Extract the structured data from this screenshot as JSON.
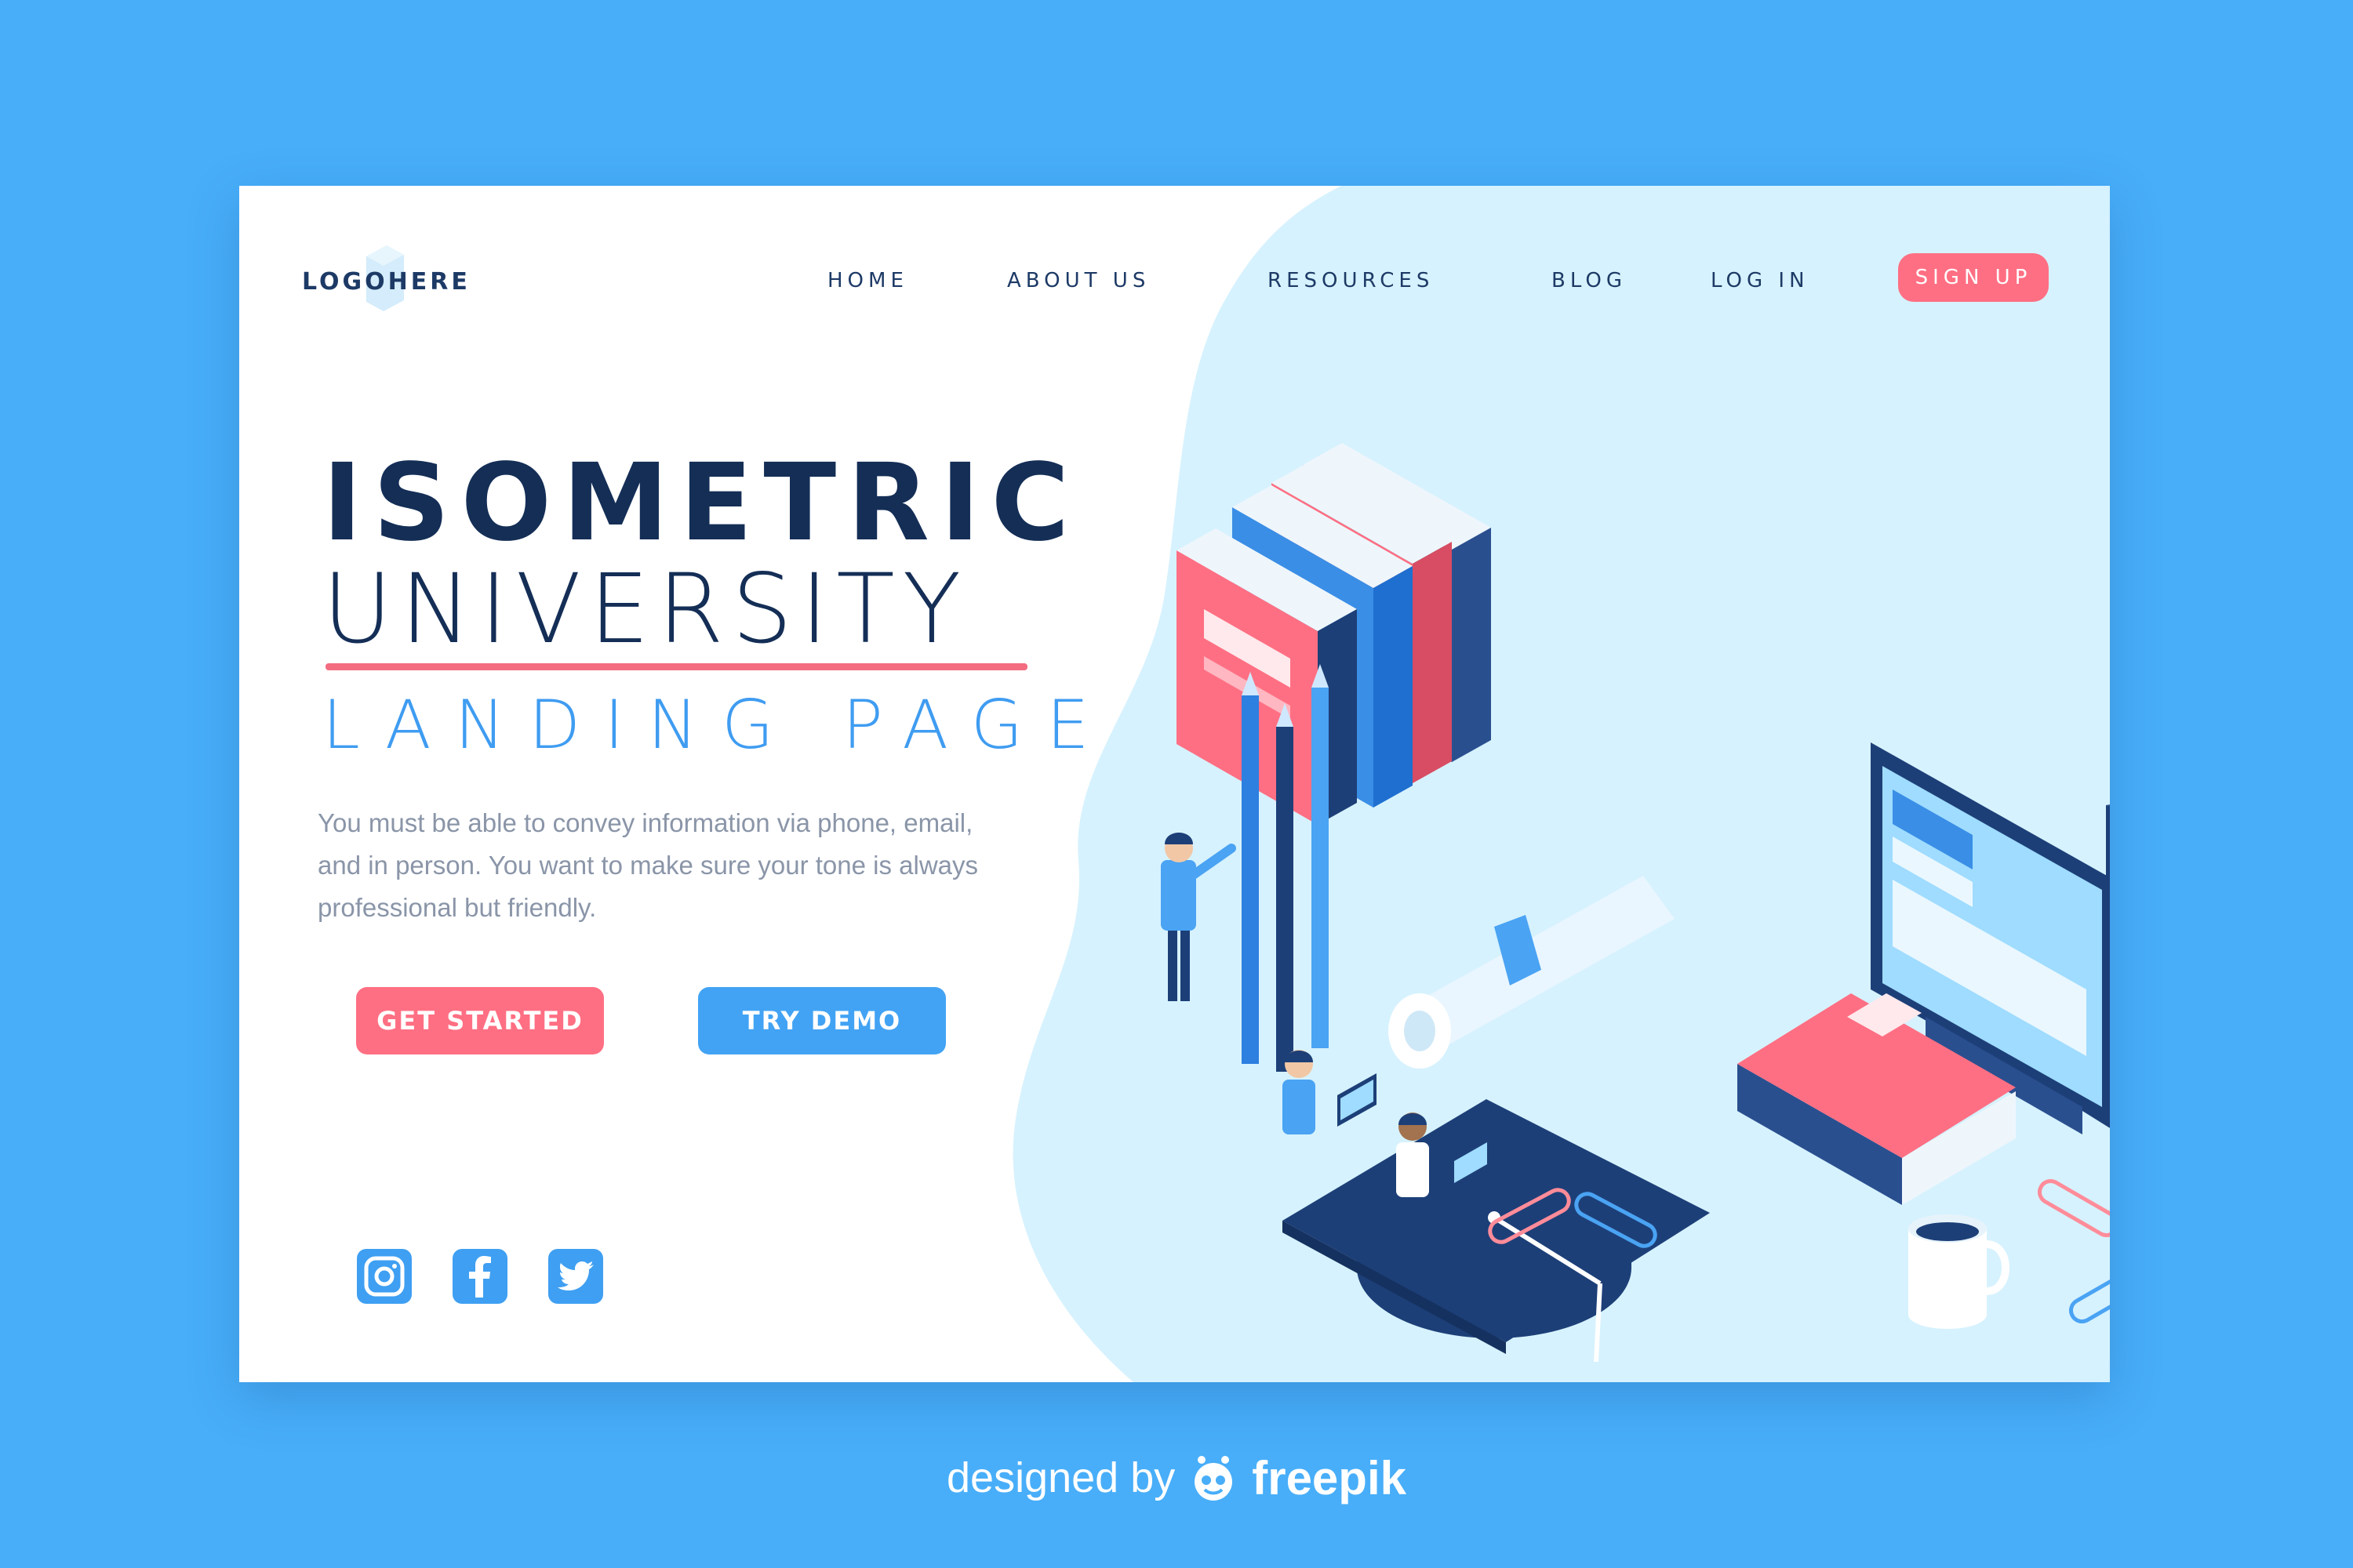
{
  "colors": {
    "page_background": "#48aef9",
    "card_background": "#ffffff",
    "blob": "#d6f2fe",
    "navy": "#142e56",
    "accent_pink": "#ff6f83",
    "accent_blue": "#42a3f4"
  },
  "header": {
    "logo": "LOGOHERE",
    "nav": [
      {
        "label": "HOME"
      },
      {
        "label": "ABOUT US"
      },
      {
        "label": "RESOURCES"
      },
      {
        "label": "BLOG"
      },
      {
        "label": "LOG IN"
      }
    ],
    "signup_label": "SIGN UP"
  },
  "hero": {
    "title_line1": "ISOMETRIC",
    "title_line2": "UNIVERSITY",
    "title_line3": "LANDING PAGE",
    "description": "You must be able to convey information via phone, email, and in person. You want to make sure your tone is always professional but friendly.",
    "primary_button": "GET STARTED",
    "secondary_button": "TRY DEMO"
  },
  "social": [
    {
      "icon": "instagram-icon"
    },
    {
      "icon": "facebook-icon"
    },
    {
      "icon": "twitter-icon"
    }
  ],
  "footer": {
    "designed_by": "designed by",
    "brand": "freepik"
  }
}
